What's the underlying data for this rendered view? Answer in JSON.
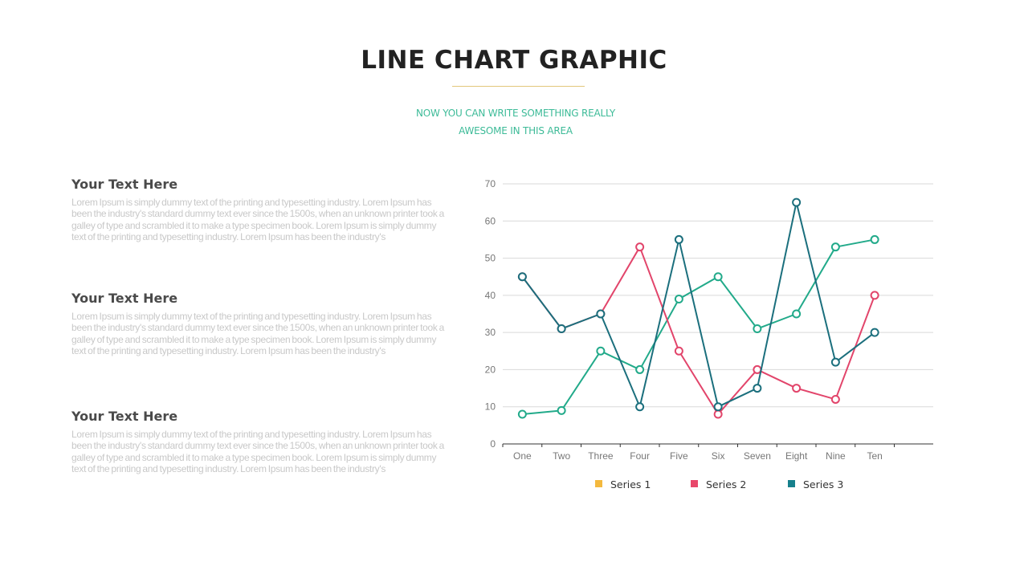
{
  "header": {
    "title": "LINE CHART GRAPHIC",
    "subtitle_line1": "NOW YOU CAN WRITE SOMETHING REALLY",
    "subtitle_line2": "AWESOME IN THIS AREA",
    "rule_color": "#e2c77a",
    "subtitle_color": "#3dbb98"
  },
  "blocks": [
    {
      "heading": "Your Text Here",
      "body": "Lorem Ipsum is simply dummy text of the printing and typesetting industry. Lorem Ipsum has been the industry's standard dummy text ever since the 1500s, when an unknown printer took a galley of type and scrambled it to make a type specimen book. Lorem Ipsum is simply dummy text of the printing and typesetting industry. Lorem Ipsum has been the industry's"
    },
    {
      "heading": "Your Text Here",
      "body": "Lorem Ipsum is simply dummy text of the printing and typesetting industry. Lorem Ipsum has been the industry's standard dummy text ever since the 1500s, when an unknown printer took a galley of type and scrambled it to make a type specimen book. Lorem Ipsum is simply dummy text of the printing and typesetting industry. Lorem Ipsum has been the industry's"
    },
    {
      "heading": "Your Text Here",
      "body": "Lorem Ipsum is simply dummy text of the printing and typesetting industry. Lorem Ipsum has been the industry's standard dummy text ever since the 1500s, when an unknown printer took a galley of type and scrambled it to make a type specimen book. Lorem Ipsum is simply dummy text of the printing and typesetting industry. Lorem Ipsum has been the industry's"
    }
  ],
  "chart_data": {
    "type": "line",
    "title": "",
    "xlabel": "",
    "ylabel": "",
    "categories": [
      "One",
      "Two",
      "Three",
      "Four",
      "Five",
      "Six",
      "Seven",
      "Eight",
      "Nine",
      "Ten"
    ],
    "ylim": [
      0,
      70
    ],
    "yticks": [
      0,
      10,
      20,
      30,
      40,
      50,
      60,
      70
    ],
    "grid": true,
    "legend_position": "bottom",
    "series": [
      {
        "name": "Series 1",
        "legend_color": "#f4b93e",
        "line_color": "#22aa8a",
        "values": [
          8,
          9,
          25,
          20,
          39,
          45,
          31,
          35,
          53,
          55
        ]
      },
      {
        "name": "Series 2",
        "legend_color": "#e8476a",
        "line_color": "#e2456b",
        "values": [
          45,
          31,
          35,
          53,
          25,
          8,
          20,
          15,
          12,
          40
        ]
      },
      {
        "name": "Series 3",
        "legend_color": "#16808c",
        "line_color": "#1b6f7d",
        "values": [
          45,
          31,
          35,
          10,
          55,
          10,
          15,
          65,
          22,
          30
        ]
      }
    ]
  }
}
